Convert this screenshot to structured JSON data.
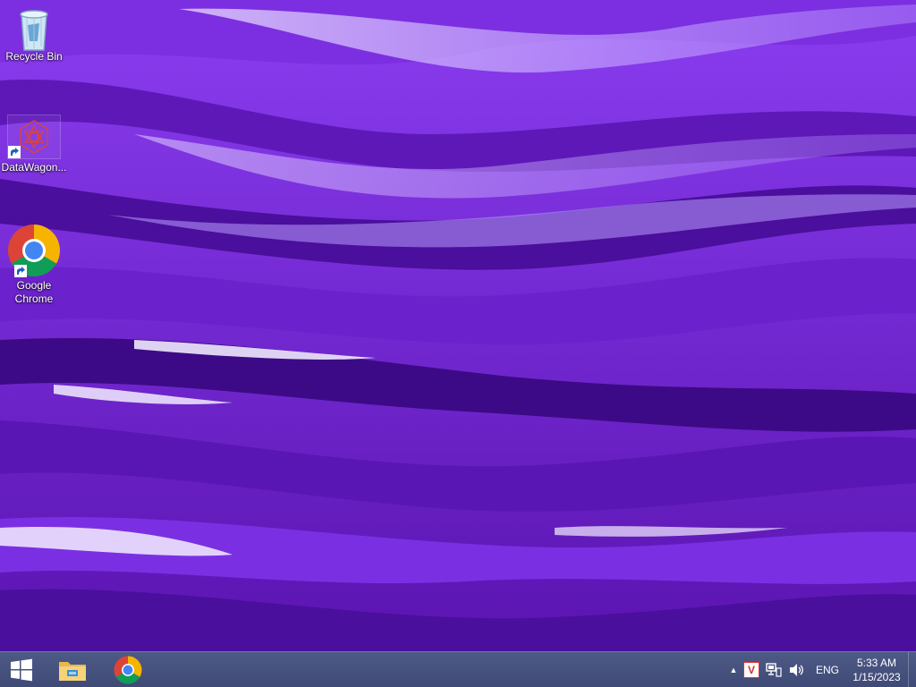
{
  "desktop": {
    "icons": [
      {
        "label": "Recycle Bin",
        "icon": "recycle-bin-icon"
      },
      {
        "label": "DataWagon...",
        "icon": "datawagon-icon",
        "shortcut": true
      },
      {
        "label": "Google\nChrome",
        "icon": "chrome-icon",
        "shortcut": true
      }
    ]
  },
  "taskbar": {
    "start": {
      "icon": "windows-logo-icon"
    },
    "pinned": [
      {
        "icon": "file-explorer-icon"
      },
      {
        "icon": "chrome-icon"
      }
    ],
    "tray": {
      "overflow_glyph": "▲",
      "app_badge": "V",
      "language": "ENG",
      "time": "5:33 AM",
      "date": "1/15/2023"
    }
  },
  "colors": {
    "wallpaper_primary": "#6a1fc4",
    "wallpaper_light": "#d9c2ff",
    "taskbar": "#46517d"
  }
}
